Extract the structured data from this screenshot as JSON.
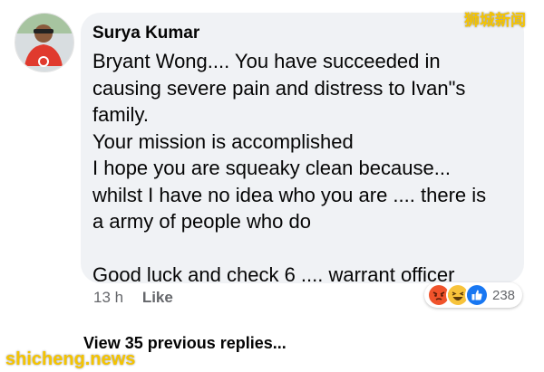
{
  "comment": {
    "author": "Surya Kumar",
    "lines": [
      "Bryant Wong.... You have succeeded in",
      "causing severe pain and distress to Ivan\"s",
      "family.",
      "Your mission is accomplished",
      "I hope you are squeaky clean because...",
      "whilst I have no idea who you are .... there is",
      "a army of people who do",
      "",
      "Good luck and check 6 .... warrant officer"
    ],
    "timestamp": "13 h",
    "like_label": "Like",
    "reactions": {
      "icons": [
        "angry-emoji-icon",
        "laugh-emoji-icon",
        "like-thumb-icon"
      ],
      "count": "238"
    }
  },
  "view_replies_label": "View 35 previous replies...",
  "watermarks": {
    "top_right": "狮城新闻",
    "bottom_left": "shicheng.news"
  },
  "colors": {
    "bubble_bg": "#f0f2f5",
    "text": "#050505",
    "meta_text": "#65676b",
    "watermark": "#f5c400",
    "like_blue": "#1877f2"
  }
}
